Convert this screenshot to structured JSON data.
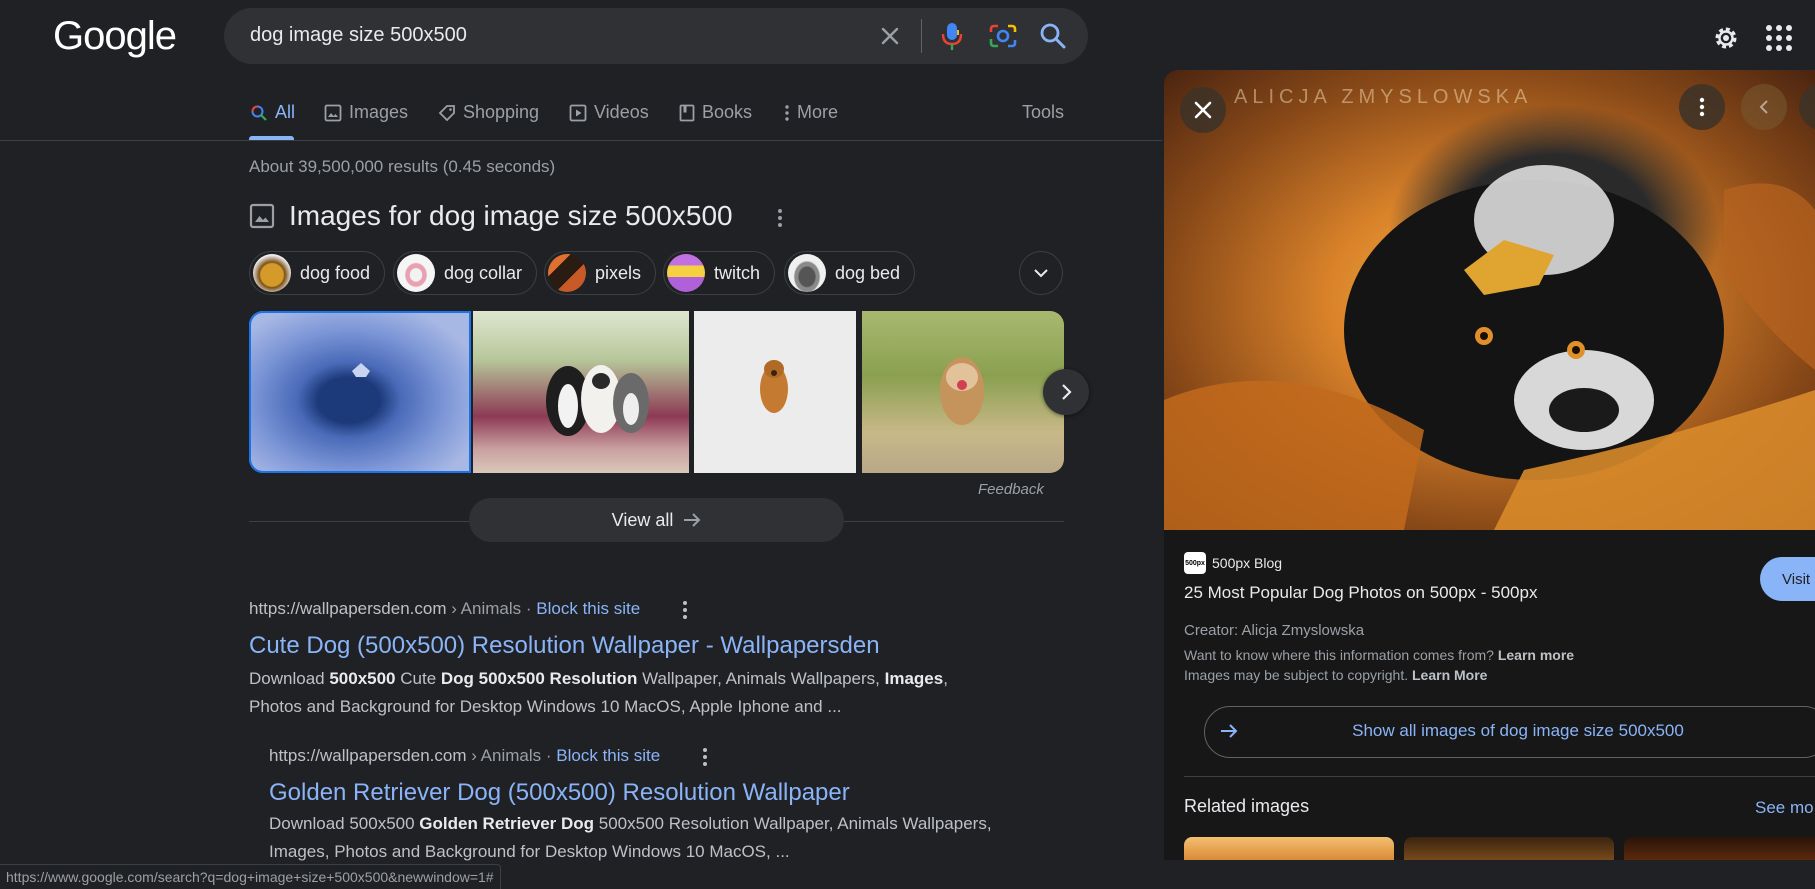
{
  "header": {
    "logo_text": "Google",
    "search_query": "dog image size 500x500"
  },
  "tabs": [
    {
      "label": "All"
    },
    {
      "label": "Images"
    },
    {
      "label": "Shopping"
    },
    {
      "label": "Videos"
    },
    {
      "label": "Books"
    },
    {
      "label": "More"
    },
    {
      "label": "Tools"
    }
  ],
  "result_stats": "About 39,500,000 results (0.45 seconds)",
  "images_block": {
    "heading": "Images for dog image size 500x500",
    "chips": [
      {
        "label": "dog food"
      },
      {
        "label": "dog collar"
      },
      {
        "label": "pixels"
      },
      {
        "label": "twitch"
      },
      {
        "label": "dog bed"
      }
    ],
    "feedback": "Feedback",
    "view_all": "View all"
  },
  "results": [
    {
      "url": "https://wallpapersden.com",
      "breadcrumb": " › Animals",
      "separator": "·",
      "block_label": "Block this site",
      "title": "Cute Dog (500x500) Resolution Wallpaper - Wallpapersden",
      "snippet_parts": [
        "Download ",
        "500x500",
        " Cute ",
        "Dog 500x500 Resolution",
        " Wallpaper, Animals Wallpapers, ",
        "Images",
        ",",
        "Photos and Background for Desktop Windows 10 MacOS, Apple Iphone and ..."
      ]
    },
    {
      "url": "https://wallpapersden.com",
      "breadcrumb": " › Animals",
      "separator": "·",
      "block_label": "Block this site",
      "title": "Golden Retriever Dog (500x500) Resolution Wallpaper",
      "snippet_parts": [
        "Download 500x500 ",
        "Golden Retriever Dog",
        " 500x500 Resolution Wallpaper, Animals Wallpapers,",
        "Images, Photos and Background for Desktop Windows 10 MacOS, ..."
      ]
    }
  ],
  "status_bar_url": "https://www.google.com/search?q=dog+image+size+500x500&newwindow=1#",
  "side_panel": {
    "watermark": "ALICJA ZMYSLOWSKA",
    "source_name": "500px Blog",
    "source_favicon_text": "500px",
    "title": "25 Most Popular Dog Photos on 500px - 500px",
    "visit_label": "Visit",
    "creator": "Creator: Alicja Zmyslowska",
    "info_text": "Want to know where this information comes from?",
    "learn_more_1": "Learn more",
    "copyright_text": "Images may be subject to copyright.",
    "learn_more_2": "Learn More",
    "show_all_label": "Show all images of dog image size 500x500",
    "related_heading": "Related images",
    "see_more": "See mo"
  },
  "colors": {
    "background": "#202124",
    "link": "#8ab4f8",
    "panel_bg": "#171717"
  }
}
